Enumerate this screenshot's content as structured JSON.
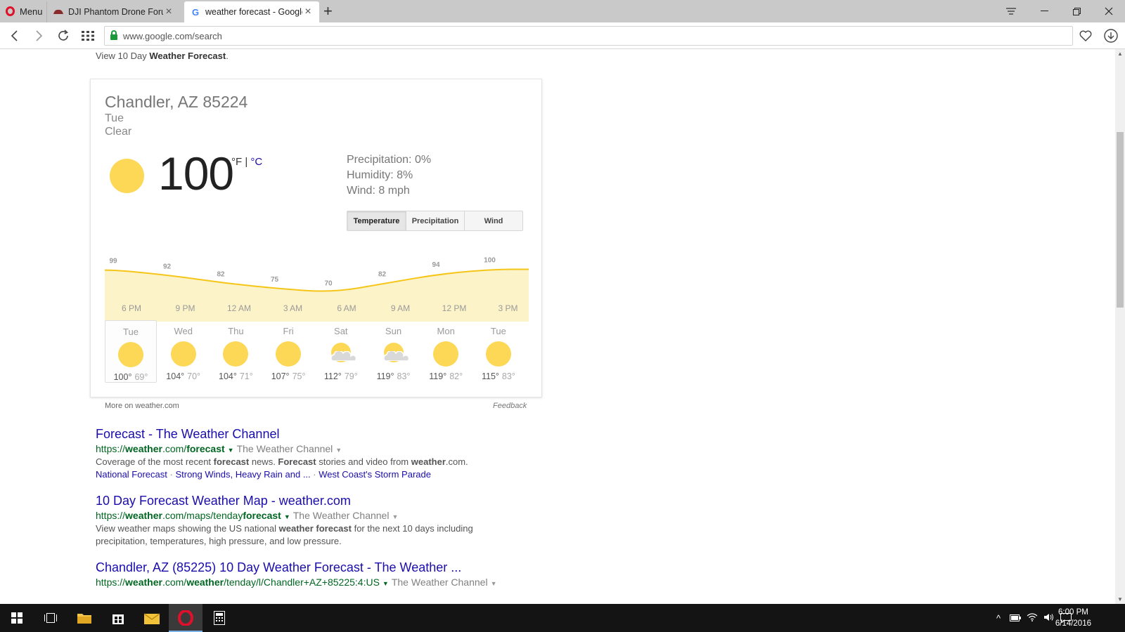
{
  "browser": {
    "menu_label": "Menu",
    "tabs": [
      {
        "title": "DJI Phantom Drone Forum",
        "favicon": "drone-icon"
      },
      {
        "title": "weather forecast - Google",
        "favicon": "google-icon"
      }
    ],
    "address": "www.google.com/search"
  },
  "page": {
    "intro_prefix": "View 10 Day ",
    "intro_bold": "Weather Forecast",
    "intro_suffix": ".",
    "weather": {
      "location": "Chandler, AZ 85224",
      "day": "Tue",
      "condition": "Clear",
      "temperature": "100",
      "unit_f": "°F",
      "unit_sep": " | ",
      "unit_c": "°C",
      "precipitation": "Precipitation: 0%",
      "humidity": "Humidity: 8%",
      "wind": "Wind: 8 mph",
      "tabs": [
        "Temperature",
        "Precipitation",
        "Wind"
      ],
      "forecast": [
        {
          "day": "Tue",
          "high": "100°",
          "low": "69°",
          "icon": "sunny-icon"
        },
        {
          "day": "Wed",
          "high": "104°",
          "low": "70°",
          "icon": "sunny-icon"
        },
        {
          "day": "Thu",
          "high": "104°",
          "low": "71°",
          "icon": "sunny-icon"
        },
        {
          "day": "Fri",
          "high": "107°",
          "low": "75°",
          "icon": "sunny-icon"
        },
        {
          "day": "Sat",
          "high": "112°",
          "low": "79°",
          "icon": "partly-cloudy-icon"
        },
        {
          "day": "Sun",
          "high": "119°",
          "low": "83°",
          "icon": "partly-cloudy-icon"
        },
        {
          "day": "Mon",
          "high": "119°",
          "low": "82°",
          "icon": "sunny-icon"
        },
        {
          "day": "Tue",
          "high": "115°",
          "low": "83°",
          "icon": "sunny-icon"
        }
      ],
      "more_link": "More on weather.com",
      "feedback": "Feedback"
    },
    "results": [
      {
        "title": "Forecast - The Weather Channel",
        "url_parts": [
          "https://",
          "weather",
          ".com/",
          "forecast"
        ],
        "site": "The Weather Channel",
        "snippet_html_parts": [
          "Coverage of the most recent ",
          "forecast",
          " news. ",
          "Forecast",
          " stories and video from ",
          "weather",
          ".com."
        ],
        "sitelinks": [
          "National Forecast",
          "Strong Winds, Heavy Rain and ...",
          "West Coast's Storm Parade"
        ]
      },
      {
        "title": "10 Day Forecast Weather Map - weather.com",
        "url_parts": [
          "https://",
          "weather",
          ".com/maps/tenday",
          "forecast"
        ],
        "site": "The Weather Channel",
        "snippet_line1_parts": [
          "View weather maps showing the US national ",
          "weather forecast",
          " for the next 10 days including"
        ],
        "snippet_line2": "precipitation, temperatures, high pressure, and low pressure."
      },
      {
        "title": "Chandler, AZ (85225) 10 Day Weather Forecast - The Weather ...",
        "url_parts": [
          "https://",
          "weather",
          ".com/",
          "weather",
          "/tenday/l/Chandler+AZ+85225:4:US"
        ],
        "site": "The Weather Channel"
      }
    ]
  },
  "taskbar": {
    "time": "6:00 PM",
    "date": "6/14/2016"
  },
  "chart_data": {
    "type": "area",
    "categories": [
      "6 PM",
      "9 PM",
      "12 AM",
      "3 AM",
      "6 AM",
      "9 AM",
      "12 PM",
      "3 PM"
    ],
    "values": [
      99,
      92,
      82,
      75,
      70,
      82,
      94,
      100
    ],
    "xlabel": "",
    "ylabel": "",
    "ylim": [
      65,
      105
    ],
    "grid": false,
    "colors": {
      "line": "#f5c518",
      "fill": "#fdf3c8"
    }
  }
}
